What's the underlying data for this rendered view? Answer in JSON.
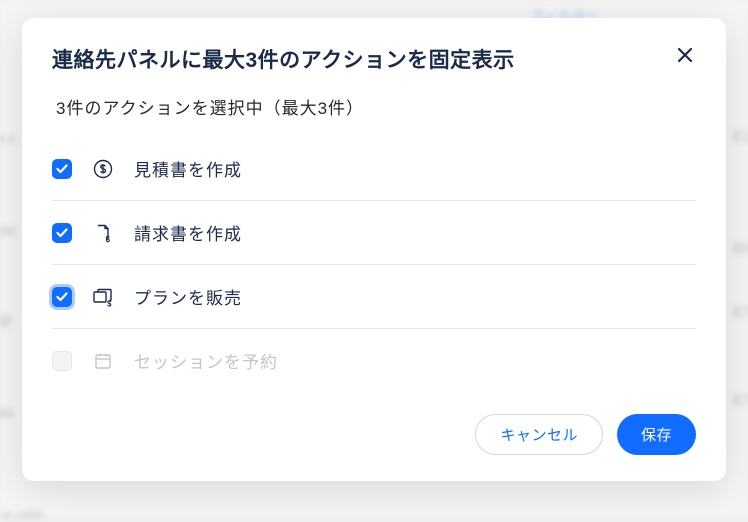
{
  "bg": {
    "filter": "フィルター",
    "snippets": [
      "x.c",
      "mc",
      "@",
      "ka",
      "ix.com",
      "E1",
      "E9",
      "E7",
      "E7"
    ]
  },
  "modal": {
    "title": "連絡先パネルに最大3件のアクションを固定表示",
    "subtitle": "3件のアクションを選択中（最大3件）",
    "items": [
      {
        "label": "見積書を作成",
        "checked": true,
        "disabled": false,
        "focused": false,
        "icon": "dollar-circle"
      },
      {
        "label": "請求書を作成",
        "checked": true,
        "disabled": false,
        "focused": false,
        "icon": "file-dollar"
      },
      {
        "label": "プランを販売",
        "checked": true,
        "disabled": false,
        "focused": true,
        "icon": "cards-dollar"
      },
      {
        "label": "セッションを予約",
        "checked": false,
        "disabled": true,
        "focused": false,
        "icon": "calendar"
      }
    ],
    "footer": {
      "cancel": "キャンセル",
      "save": "保存"
    }
  }
}
